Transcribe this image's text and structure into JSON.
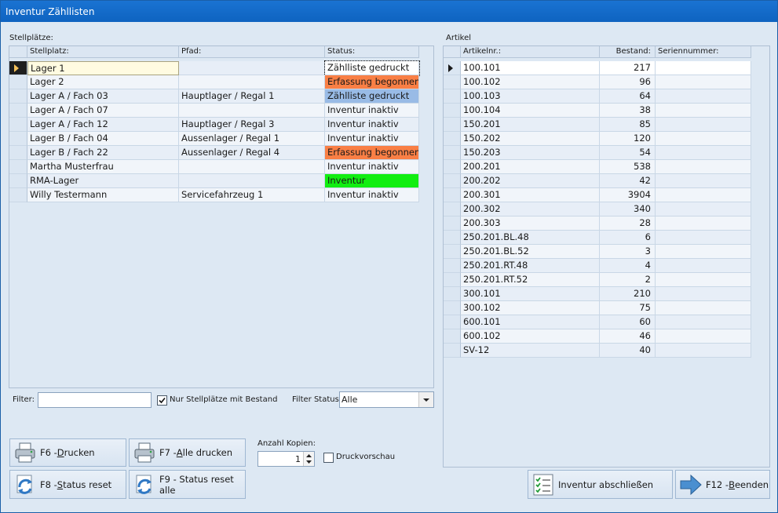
{
  "window": {
    "title": "Inventur Zähllisten"
  },
  "left": {
    "group_label": "Stellplätze:",
    "columns": [
      "Stellplatz:",
      "Pfad:",
      "Status:"
    ],
    "rows": [
      {
        "stellplatz": "Lager 1",
        "pfad": "",
        "status": "Zählliste gedruckt",
        "status_color": "#ffffff",
        "selected": true
      },
      {
        "stellplatz": "Lager 2",
        "pfad": "",
        "status": "Erfassung begonnen",
        "status_color": "#f97f45"
      },
      {
        "stellplatz": "Lager A / Fach 03",
        "pfad": "Hauptlager / Regal 1",
        "status": "Zählliste gedruckt",
        "status_color": "#99bbe6"
      },
      {
        "stellplatz": "Lager A / Fach 07",
        "pfad": "",
        "status": "Inventur inaktiv",
        "status_color": ""
      },
      {
        "stellplatz": "Lager A / Fach 12",
        "pfad": "Hauptlager / Regal 3",
        "status": "Inventur inaktiv",
        "status_color": ""
      },
      {
        "stellplatz": "Lager B / Fach 04",
        "pfad": "Aussenlager / Regal 1",
        "status": "Inventur inaktiv",
        "status_color": ""
      },
      {
        "stellplatz": "Lager B / Fach 22",
        "pfad": "Aussenlager / Regal 4",
        "status": "Erfassung begonnen",
        "status_color": "#f97f45"
      },
      {
        "stellplatz": "Martha Musterfrau",
        "pfad": "",
        "status": "Inventur inaktiv",
        "status_color": ""
      },
      {
        "stellplatz": "RMA-Lager",
        "pfad": "",
        "status": "Inventur",
        "status_color": "#11ee11"
      },
      {
        "stellplatz": "Willy Testermann",
        "pfad": "Servicefahrzeug 1",
        "status": "Inventur inaktiv",
        "status_color": ""
      }
    ]
  },
  "right": {
    "group_label": "Artikel",
    "columns": [
      "Artikelnr.:",
      "Bestand:",
      "Seriennummer:"
    ],
    "rows": [
      {
        "nr": "100.101",
        "bestand": "217",
        "selected": true
      },
      {
        "nr": "100.102",
        "bestand": "96"
      },
      {
        "nr": "100.103",
        "bestand": "64"
      },
      {
        "nr": "100.104",
        "bestand": "38"
      },
      {
        "nr": "150.201",
        "bestand": "85"
      },
      {
        "nr": "150.202",
        "bestand": "120"
      },
      {
        "nr": "150.203",
        "bestand": "54"
      },
      {
        "nr": "200.201",
        "bestand": "538"
      },
      {
        "nr": "200.202",
        "bestand": "42"
      },
      {
        "nr": "200.301",
        "bestand": "3904"
      },
      {
        "nr": "200.302",
        "bestand": "340"
      },
      {
        "nr": "200.303",
        "bestand": "28"
      },
      {
        "nr": "250.201.BL.48",
        "bestand": "6"
      },
      {
        "nr": "250.201.BL.52",
        "bestand": "3"
      },
      {
        "nr": "250.201.RT.48",
        "bestand": "4"
      },
      {
        "nr": "250.201.RT.52",
        "bestand": "2"
      },
      {
        "nr": "300.101",
        "bestand": "210"
      },
      {
        "nr": "300.102",
        "bestand": "75"
      },
      {
        "nr": "600.101",
        "bestand": "60"
      },
      {
        "nr": "600.102",
        "bestand": "46"
      },
      {
        "nr": "SV-12",
        "bestand": "40"
      }
    ]
  },
  "filter": {
    "label": "Filter:",
    "value": "",
    "only_with_stock_label": "Nur Stellplätze mit Bestand",
    "only_with_stock_checked": true,
    "status_label": "Filter Status:",
    "status_value": "Alle"
  },
  "print": {
    "copies_label": "Anzahl Kopien:",
    "copies_value": "1",
    "preview_label": "Druckvorschau",
    "preview_checked": false
  },
  "buttons": {
    "print": {
      "pre": "F6 - ",
      "key": "D",
      "post": "rucken"
    },
    "print_all": {
      "pre": "F7 - ",
      "key": "A",
      "post": "lle drucken"
    },
    "status_reset": {
      "pre": "F8 - ",
      "key": "S",
      "post": "tatus reset"
    },
    "status_reset_all": {
      "line1": "F9 - Status reset",
      "line2": "alle"
    },
    "finish": "Inventur abschließen",
    "exit": {
      "pre": "F12 - ",
      "key": "B",
      "post": "eenden"
    }
  },
  "icons": {
    "printer": "printer-icon",
    "reset": "refresh-icon",
    "checklist": "checklist-icon",
    "exit": "arrow-right-icon"
  }
}
